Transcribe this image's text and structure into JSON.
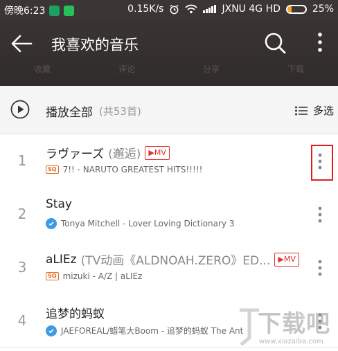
{
  "status": {
    "time": "傍晚6:23",
    "speed": "0.15K/s",
    "carrier": "JXNU 4G HD",
    "battery": "25%",
    "battery_level": 0.25
  },
  "header": {
    "title": "我喜欢的音乐",
    "tabs": [
      "收藏",
      "评论",
      "分享",
      "下载"
    ]
  },
  "playall": {
    "label": "播放全部",
    "count": "(共53首)",
    "multiselect": "多选"
  },
  "songs": [
    {
      "num": "1",
      "title": "ラヴァーズ",
      "alias": "(邂逅)",
      "mv": "MV",
      "sq": true,
      "verified": false,
      "subtitle": "7!! - NARUTO GREATEST HITS!!!!!"
    },
    {
      "num": "2",
      "title": "Stay",
      "alias": "",
      "mv": "",
      "sq": false,
      "verified": true,
      "subtitle": "Tonya Mitchell - Lover Loving Dictionary 3"
    },
    {
      "num": "3",
      "title": "aLIEz",
      "alias": "(TV动画《ALDNOAH.ZERO》ED...",
      "mv": "MV",
      "sq": true,
      "verified": false,
      "subtitle": "mizuki - A/Z | aLIEz"
    },
    {
      "num": "4",
      "title": "追梦的蚂蚁",
      "alias": "",
      "mv": "",
      "sq": false,
      "verified": true,
      "subtitle": "JAEFOREAL/蜡笔大Boom - 追梦的蚂蚁 The Ant"
    }
  ],
  "badges": {
    "sq": "SQ"
  },
  "watermark": {
    "text": "下载吧",
    "url": "www.xiazaiba.com"
  },
  "colors": {
    "header_bg": "#3a3534",
    "accent": "#e0312b",
    "verified": "#3b9be6",
    "highlight": "#e01e1e"
  }
}
